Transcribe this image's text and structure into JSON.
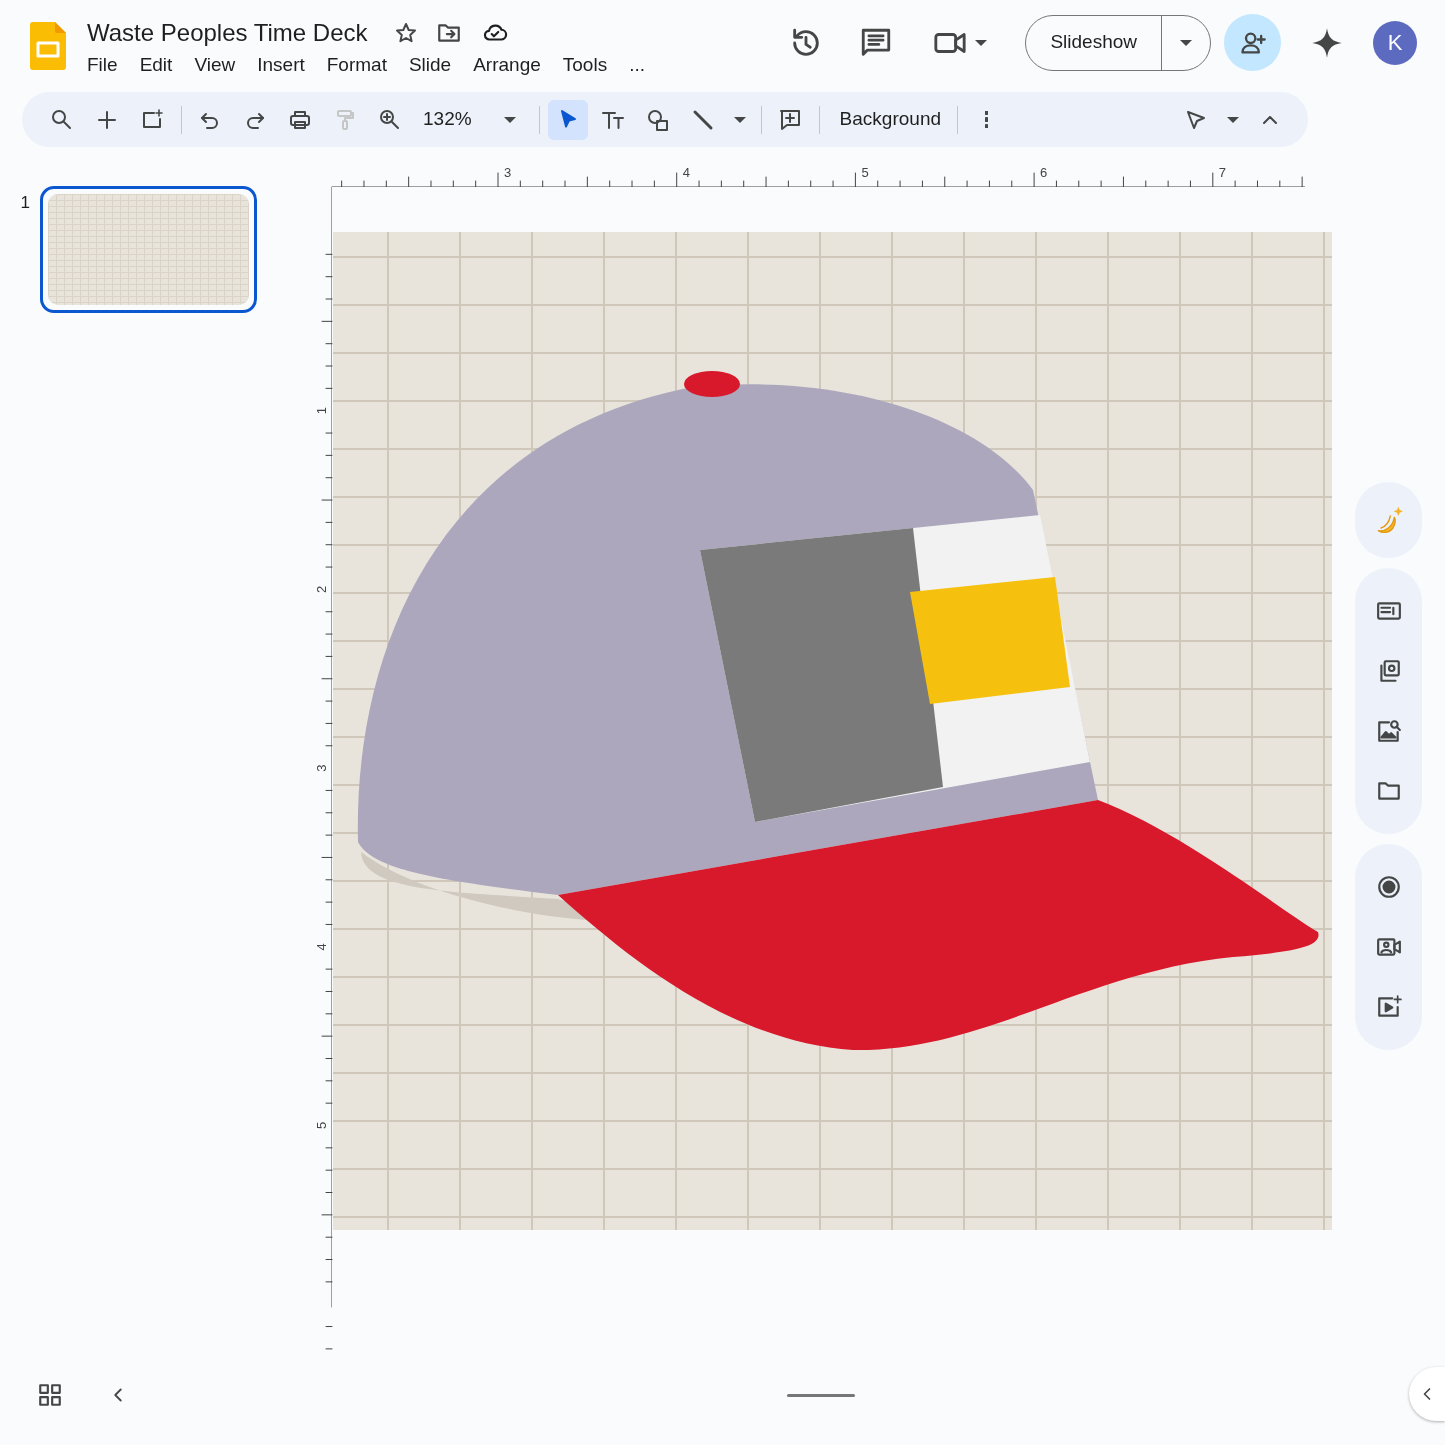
{
  "document": {
    "title": "Waste Peoples Time Deck",
    "starred": false
  },
  "menu": [
    "File",
    "Edit",
    "View",
    "Insert",
    "Format",
    "Slide",
    "Arrange",
    "Tools",
    "..."
  ],
  "header": {
    "slideshow_button": "Slideshow",
    "avatar": "K"
  },
  "toolbar": {
    "zoom": "132%",
    "background_button": "Background",
    "paint_format_disabled": true,
    "tools": [
      {
        "selected": true
      },
      {
        "selected": false
      },
      {
        "selected": false
      },
      {
        "selected": false
      }
    ]
  },
  "ruler": {
    "top_labels": [
      "3",
      "4",
      "5",
      "6",
      "7"
    ],
    "left_labels": [
      "1",
      "2",
      "3",
      "4",
      "5"
    ]
  },
  "slides": [
    {
      "number": "1",
      "selected": true
    }
  ]
}
